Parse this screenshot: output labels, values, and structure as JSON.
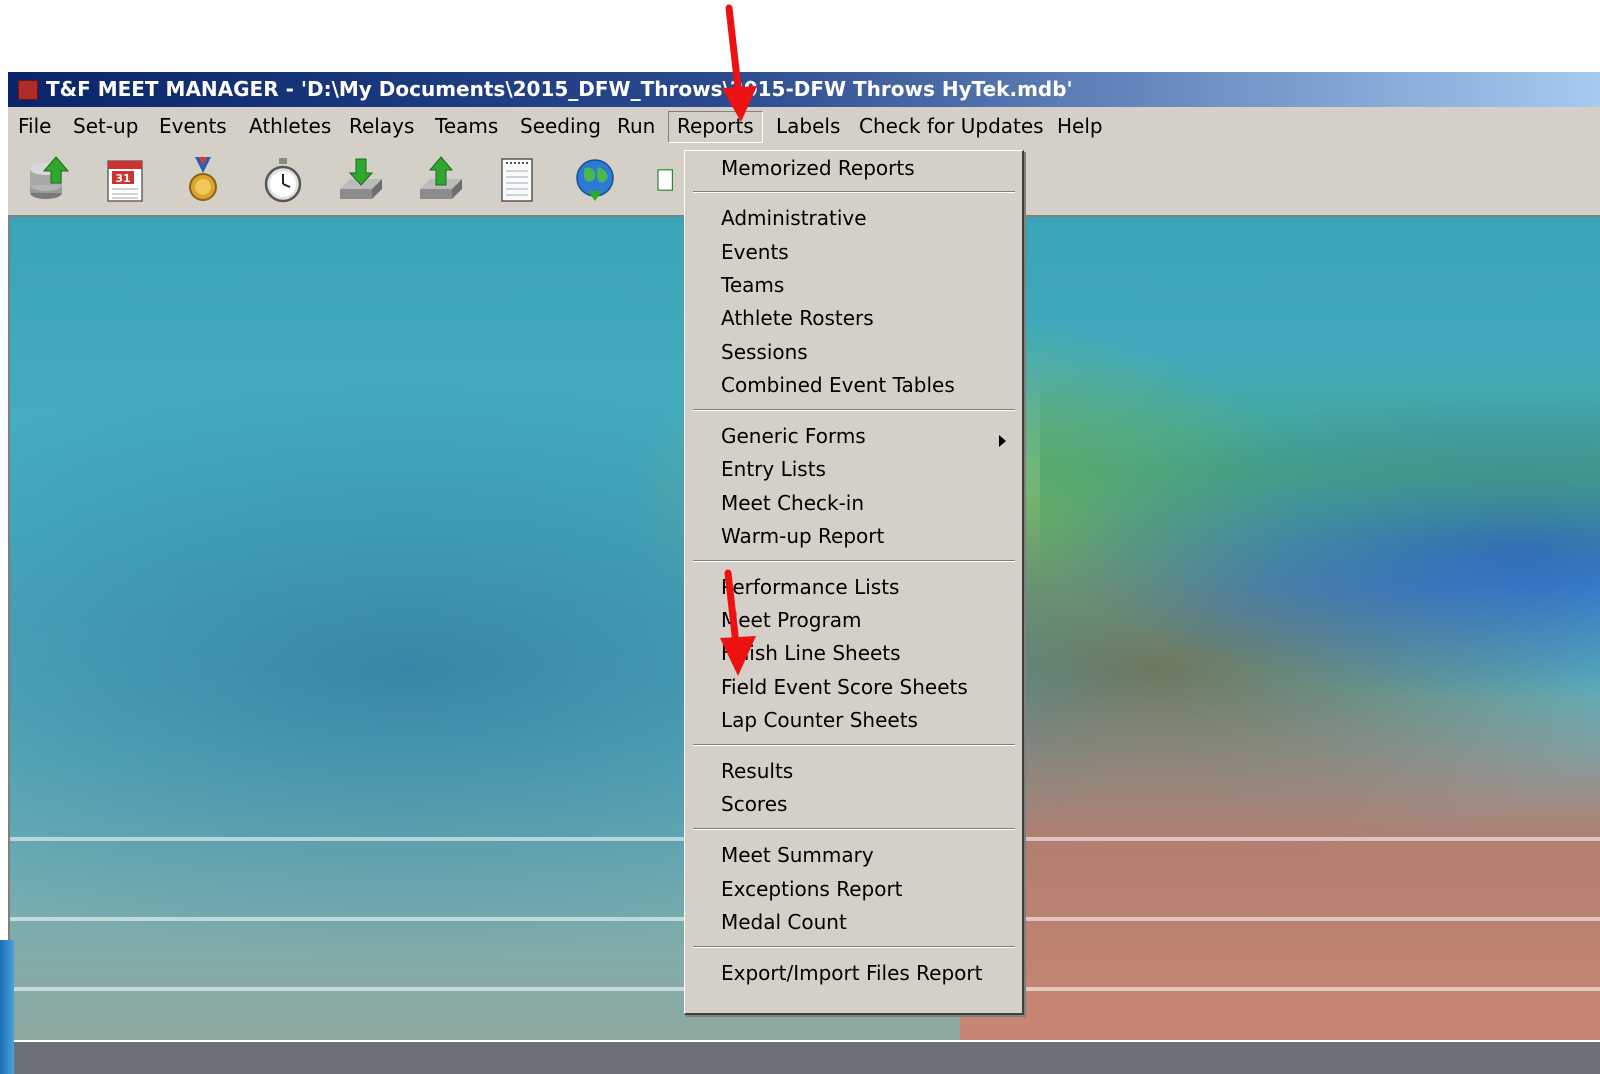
{
  "window": {
    "title": "T&F MEET MANAGER - 'D:\\My Documents\\2015_DFW_Throws\\2015-DFW Throws HyTek.mdb'"
  },
  "menubar": {
    "items": [
      {
        "label": "File"
      },
      {
        "label": "Set-up"
      },
      {
        "label": "Events"
      },
      {
        "label": "Athletes"
      },
      {
        "label": "Relays"
      },
      {
        "label": "Teams"
      },
      {
        "label": "Seeding"
      },
      {
        "label": "Run"
      },
      {
        "label": "Reports",
        "active": true
      },
      {
        "label": "Labels"
      },
      {
        "label": "Check for Updates"
      },
      {
        "label": "Help"
      }
    ]
  },
  "toolbar": {
    "buttons": [
      {
        "icon": "database-upload-icon"
      },
      {
        "icon": "calendar-icon"
      },
      {
        "icon": "medal-icon"
      },
      {
        "icon": "stopwatch-icon"
      },
      {
        "icon": "import-download-icon"
      },
      {
        "icon": "export-upload-icon"
      },
      {
        "icon": "notepad-icon"
      },
      {
        "icon": "globe-icon"
      }
    ],
    "calendar_day": "31"
  },
  "reports_menu": {
    "items": [
      {
        "label": "Memorized Reports"
      },
      {
        "label": "Administrative"
      },
      {
        "label": "Events"
      },
      {
        "label": "Teams"
      },
      {
        "label": "Athlete Rosters"
      },
      {
        "label": "Sessions"
      },
      {
        "label": "Combined Event Tables"
      },
      {
        "label": "Generic Forms",
        "has_submenu": true
      },
      {
        "label": "Entry Lists"
      },
      {
        "label": "Meet Check-in"
      },
      {
        "label": "Warm-up Report"
      },
      {
        "label": "Performance Lists"
      },
      {
        "label": "Meet Program"
      },
      {
        "label": "Finish Line Sheets"
      },
      {
        "label": "Field Event Score Sheets"
      },
      {
        "label": "Lap Counter Sheets"
      },
      {
        "label": "Results"
      },
      {
        "label": "Scores"
      },
      {
        "label": "Meet Summary"
      },
      {
        "label": "Exceptions Report"
      },
      {
        "label": "Medal Count"
      },
      {
        "label": "Export/Import Files Report"
      }
    ]
  },
  "colors": {
    "titlebar_start": "#0a246a",
    "titlebar_end": "#a6caf0",
    "window_face": "#d4d0c8",
    "annotation_arrow": "#ee1111"
  }
}
